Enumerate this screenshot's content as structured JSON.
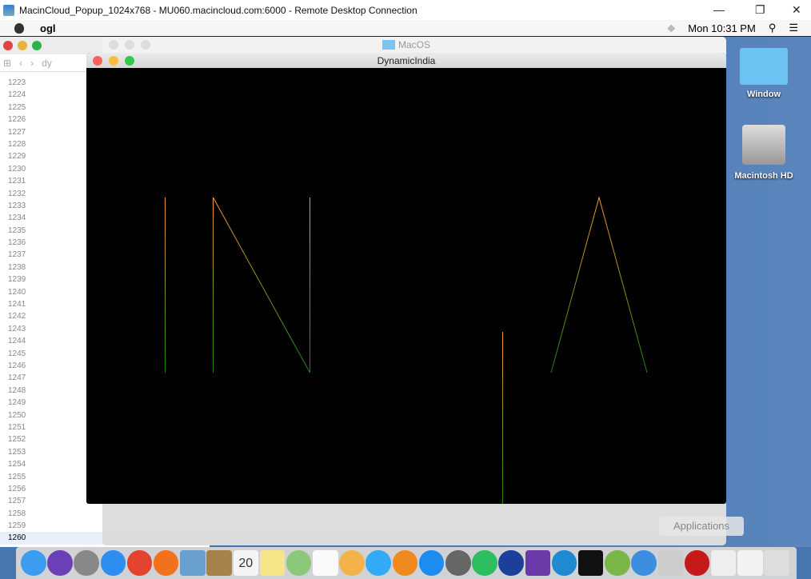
{
  "rdp": {
    "title": "MacinCloud_Popup_1024x768 - MU060.macincloud.com:6000 - Remote Desktop Connection",
    "min": "—",
    "restore": "❐",
    "close": "✕"
  },
  "menubar": {
    "app": "ogl",
    "clock": "Mon 10:31 PM"
  },
  "xcode": {
    "file": "dy",
    "lines": [
      "1223",
      "1224",
      "1225",
      "1226",
      "1227",
      "1228",
      "1229",
      "1230",
      "1231",
      "1232",
      "1233",
      "1234",
      "1235",
      "1236",
      "1237",
      "1238",
      "1239",
      "1240",
      "1241",
      "1242",
      "1243",
      "1244",
      "1245",
      "1246",
      "1247",
      "1248",
      "1249",
      "1250",
      "1251",
      "1252",
      "1253",
      "1254",
      "1255",
      "1256",
      "1257",
      "1258",
      "1259",
      "1260"
    ],
    "code_1258": "}*/",
    "code_1259": "}"
  },
  "finder": {
    "title": "MacOS"
  },
  "gl_window": {
    "title": "DynamicIndia",
    "colors": {
      "saffron": "#FF9933",
      "green": "#138808"
    }
  },
  "desktop": {
    "icons": [
      {
        "label": "Window"
      },
      {
        "label": "Macintosh HD"
      }
    ]
  },
  "dock": {
    "tooltip": "Applications",
    "items": [
      {
        "name": "finder",
        "color": "#3b9cf0"
      },
      {
        "name": "siri",
        "color": "#6a3fb8"
      },
      {
        "name": "launchpad",
        "color": "#888"
      },
      {
        "name": "safari",
        "color": "#2e8df0"
      },
      {
        "name": "chrome",
        "color": "#e4442f"
      },
      {
        "name": "firefox",
        "color": "#f2711c"
      },
      {
        "name": "preview",
        "color": "#6aa0d0"
      },
      {
        "name": "contacts",
        "color": "#a5814c"
      },
      {
        "name": "calendar",
        "color": "#f5f5f5"
      },
      {
        "name": "notes",
        "color": "#f7e58a"
      },
      {
        "name": "maps",
        "color": "#8cc87a"
      },
      {
        "name": "reminders",
        "color": "#fafafa"
      },
      {
        "name": "photos",
        "color": "#f3b24a"
      },
      {
        "name": "messages",
        "color": "#33aaf5"
      },
      {
        "name": "books",
        "color": "#f08a1e"
      },
      {
        "name": "app-store",
        "color": "#1d8cf0"
      },
      {
        "name": "system-preferences",
        "color": "#666"
      },
      {
        "name": "evernote",
        "color": "#2dbe60"
      },
      {
        "name": "dropbox",
        "color": "#1b3f9a"
      },
      {
        "name": "visual-studio",
        "color": "#6b3aa8"
      },
      {
        "name": "vscode",
        "color": "#1f8ad2"
      },
      {
        "name": "terminal",
        "color": "#111"
      },
      {
        "name": "android-studio",
        "color": "#7ab648"
      },
      {
        "name": "xcode",
        "color": "#3d8ee0"
      },
      {
        "name": "instruments",
        "color": "#ccc"
      },
      {
        "name": "acrobat",
        "color": "#c41a1a"
      },
      {
        "name": "mm-file",
        "color": "#eee"
      },
      {
        "name": "document",
        "color": "#f3f3f3"
      },
      {
        "name": "trash",
        "color": "#ddd"
      }
    ],
    "calendar_day": "20"
  }
}
